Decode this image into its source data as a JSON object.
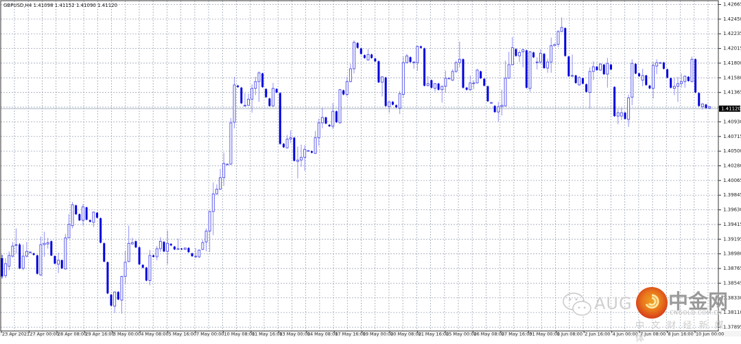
{
  "header": {
    "symbol": "GBPUSD,H4",
    "ohlc": "1.41098 1.41152 1.41090 1.41120"
  },
  "watermark": {
    "prefix": "AUG",
    "brand": "中金网",
    "domain": "CNGOLD.COM.CN",
    "slogan": "中 文 财 经 新 媒 体"
  },
  "colors": {
    "bull": "#4b4be8",
    "bear": "#0000dd",
    "wick": "#6a6af0",
    "grid": "#9aa4b4",
    "price_line": "#a8b4c4",
    "price_box": "#000000"
  },
  "chart_data": {
    "type": "candlestick",
    "title": "GBPUSD,H4",
    "ylim": [
      1.37895,
      1.42665
    ],
    "current_price": 1.4112,
    "current_price_label": "1.41120",
    "y_ticks": [
      "1.42665",
      "1.42450",
      "1.42235",
      "1.42015",
      "1.41800",
      "1.41580",
      "1.41365",
      "1.41145",
      "1.40930",
      "1.40715",
      "1.40500",
      "1.40280",
      "1.40065",
      "1.39845",
      "1.39630",
      "1.39415",
      "1.39195",
      "1.38980",
      "1.38765",
      "1.38545",
      "1.38330",
      "1.38110",
      "1.37895"
    ],
    "x_ticks": [
      "23 Apr 2021",
      "27 Apr 00:00",
      "28 Apr 08:00",
      "29 Apr 16:00",
      "3 May 00:00",
      "4 May 08:00",
      "5 May 16:00",
      "7 May 00:00",
      "10 May 08:00",
      "11 May 16:00",
      "13 May 00:00",
      "14 May 08:00",
      "17 May 16:00",
      "19 May 00:00",
      "20 May 08:00",
      "21 May 16:00",
      "25 May 00:00",
      "26 May 08:00",
      "27 May 16:00",
      "31 May 00:00",
      "1 Jun 08:00",
      "2 Jun 16:00",
      "4 Jun 00:00",
      "7 Jun 08:00",
      "8 Jun 16:00",
      "10 Jun 00:00"
    ],
    "candles_ohlc": [
      [
        1.3891,
        1.3896,
        1.3861,
        1.3864
      ],
      [
        1.3865,
        1.3891,
        1.3862,
        1.3883
      ],
      [
        1.3879,
        1.3901,
        1.3873,
        1.3895
      ],
      [
        1.3894,
        1.3915,
        1.3892,
        1.3909
      ],
      [
        1.391,
        1.3935,
        1.3898,
        1.3911
      ],
      [
        1.3911,
        1.3913,
        1.3875,
        1.3876
      ],
      [
        1.3876,
        1.3911,
        1.3873,
        1.3894
      ],
      [
        1.3894,
        1.3915,
        1.3892,
        1.3901
      ],
      [
        1.39,
        1.3901,
        1.3899,
        1.39
      ],
      [
        1.3898,
        1.3899,
        1.3895,
        1.3896
      ],
      [
        1.3895,
        1.3896,
        1.3867,
        1.3868
      ],
      [
        1.3866,
        1.3923,
        1.3865,
        1.3911
      ],
      [
        1.3911,
        1.393,
        1.3893,
        1.3913
      ],
      [
        1.3912,
        1.3921,
        1.3905,
        1.3914
      ],
      [
        1.3916,
        1.3917,
        1.3894,
        1.3895
      ],
      [
        1.3894,
        1.3895,
        1.3882,
        1.3883
      ],
      [
        1.3882,
        1.3899,
        1.3869,
        1.3888
      ],
      [
        1.3888,
        1.3889,
        1.3875,
        1.3876
      ],
      [
        1.3875,
        1.3927,
        1.3874,
        1.3921
      ],
      [
        1.3921,
        1.3956,
        1.3921,
        1.3941
      ],
      [
        1.3939,
        1.3974,
        1.3935,
        1.397
      ],
      [
        1.3969,
        1.397,
        1.3955,
        1.3956
      ],
      [
        1.3956,
        1.3957,
        1.3946,
        1.3947
      ],
      [
        1.3947,
        1.3971,
        1.3939,
        1.3967
      ],
      [
        1.3966,
        1.3967,
        1.3947,
        1.3948
      ],
      [
        1.3947,
        1.3948,
        1.3944,
        1.3945
      ],
      [
        1.3944,
        1.396,
        1.3937,
        1.3959
      ],
      [
        1.3958,
        1.3959,
        1.395,
        1.3951
      ],
      [
        1.395,
        1.3951,
        1.3913,
        1.3914
      ],
      [
        1.3913,
        1.3914,
        1.3885,
        1.3886
      ],
      [
        1.3885,
        1.3886,
        1.3838,
        1.3839
      ],
      [
        1.3837,
        1.3838,
        1.382,
        1.3821
      ],
      [
        1.382,
        1.3842,
        1.381,
        1.3841
      ],
      [
        1.3841,
        1.3842,
        1.3829,
        1.383
      ],
      [
        1.3829,
        1.3865,
        1.3809,
        1.3864
      ],
      [
        1.3864,
        1.3902,
        1.3853,
        1.3885
      ],
      [
        1.3886,
        1.3939,
        1.3885,
        1.3913
      ],
      [
        1.3912,
        1.3921,
        1.3911,
        1.3914
      ],
      [
        1.3916,
        1.3917,
        1.3906,
        1.3907
      ],
      [
        1.3907,
        1.3908,
        1.3881,
        1.3882
      ],
      [
        1.3881,
        1.3882,
        1.3876,
        1.3877
      ],
      [
        1.3877,
        1.3878,
        1.3857,
        1.3858
      ],
      [
        1.3858,
        1.3903,
        1.3851,
        1.3895
      ],
      [
        1.3895,
        1.3896,
        1.3892,
        1.3893
      ],
      [
        1.3893,
        1.3909,
        1.3888,
        1.3905
      ],
      [
        1.3905,
        1.3922,
        1.39,
        1.3916
      ],
      [
        1.3915,
        1.3916,
        1.39,
        1.3901
      ],
      [
        1.3901,
        1.3932,
        1.3882,
        1.3913
      ],
      [
        1.3912,
        1.3913,
        1.3909,
        1.391
      ],
      [
        1.3908,
        1.3909,
        1.3903,
        1.3904
      ],
      [
        1.3905,
        1.392,
        1.3904,
        1.3905
      ],
      [
        1.3905,
        1.3906,
        1.3903,
        1.3904
      ],
      [
        1.3904,
        1.3907,
        1.3903,
        1.3906
      ],
      [
        1.3906,
        1.3907,
        1.3899,
        1.39
      ],
      [
        1.3898,
        1.3899,
        1.3893,
        1.3894
      ],
      [
        1.3894,
        1.3906,
        1.3891,
        1.3894
      ],
      [
        1.3893,
        1.3904,
        1.3891,
        1.3903
      ],
      [
        1.3904,
        1.3918,
        1.3903,
        1.3914
      ],
      [
        1.3915,
        1.3935,
        1.3901,
        1.3931
      ],
      [
        1.3931,
        1.3961,
        1.39,
        1.396
      ],
      [
        1.396,
        1.4003,
        1.3925,
        1.3986
      ],
      [
        1.3986,
        1.4,
        1.3985,
        1.3993
      ],
      [
        1.3993,
        1.4023,
        1.3992,
        1.401
      ],
      [
        1.401,
        1.4047,
        1.3998,
        1.4031
      ],
      [
        1.403,
        1.4031,
        1.4029,
        1.403
      ],
      [
        1.403,
        1.4098,
        1.4029,
        1.4091
      ],
      [
        1.4092,
        1.4159,
        1.4083,
        1.4147
      ],
      [
        1.4146,
        1.4147,
        1.4143,
        1.4144
      ],
      [
        1.4143,
        1.4144,
        1.4119,
        1.412
      ],
      [
        1.4117,
        1.4135,
        1.4115,
        1.4117
      ],
      [
        1.4117,
        1.4134,
        1.4117,
        1.4126
      ],
      [
        1.4126,
        1.4148,
        1.4106,
        1.4142
      ],
      [
        1.4142,
        1.4159,
        1.4132,
        1.4152
      ],
      [
        1.4152,
        1.4167,
        1.4122,
        1.4165
      ],
      [
        1.4164,
        1.4165,
        1.4143,
        1.4144
      ],
      [
        1.4141,
        1.4142,
        1.4128,
        1.4129
      ],
      [
        1.4127,
        1.4128,
        1.4115,
        1.4116
      ],
      [
        1.4116,
        1.415,
        1.4115,
        1.4142
      ],
      [
        1.4141,
        1.4142,
        1.4135,
        1.4136
      ],
      [
        1.4135,
        1.4136,
        1.4059,
        1.406
      ],
      [
        1.406,
        1.4061,
        1.4054,
        1.4055
      ],
      [
        1.4054,
        1.4073,
        1.4053,
        1.4067
      ],
      [
        1.4067,
        1.408,
        1.4061,
        1.4069
      ],
      [
        1.4069,
        1.407,
        1.4034,
        1.4035
      ],
      [
        1.4034,
        1.4056,
        1.4009,
        1.4036
      ],
      [
        1.4036,
        1.4059,
        1.4026,
        1.404
      ],
      [
        1.404,
        1.4058,
        1.402,
        1.4052
      ],
      [
        1.405,
        1.4051,
        1.4049,
        1.405
      ],
      [
        1.4049,
        1.405,
        1.4046,
        1.4047
      ],
      [
        1.4046,
        1.4079,
        1.4045,
        1.4069
      ],
      [
        1.4069,
        1.4097,
        1.4057,
        1.4091
      ],
      [
        1.4091,
        1.4113,
        1.4083,
        1.4099
      ],
      [
        1.4099,
        1.41,
        1.4089,
        1.409
      ],
      [
        1.4088,
        1.4089,
        1.4085,
        1.4086
      ],
      [
        1.4086,
        1.412,
        1.4082,
        1.4108
      ],
      [
        1.4108,
        1.4109,
        1.4091,
        1.4092
      ],
      [
        1.4091,
        1.4141,
        1.409,
        1.414
      ],
      [
        1.4139,
        1.414,
        1.4132,
        1.4133
      ],
      [
        1.4133,
        1.4159,
        1.413,
        1.4152
      ],
      [
        1.4152,
        1.4178,
        1.4151,
        1.4171
      ],
      [
        1.4171,
        1.4213,
        1.4164,
        1.421
      ],
      [
        1.4209,
        1.421,
        1.4201,
        1.4202
      ],
      [
        1.4201,
        1.4202,
        1.4192,
        1.4193
      ],
      [
        1.4191,
        1.4192,
        1.4186,
        1.4187
      ],
      [
        1.4184,
        1.42,
        1.4183,
        1.4192
      ],
      [
        1.4192,
        1.4193,
        1.4186,
        1.4187
      ],
      [
        1.4186,
        1.4187,
        1.4181,
        1.4182
      ],
      [
        1.4182,
        1.4183,
        1.415,
        1.4151
      ],
      [
        1.4151,
        1.416,
        1.413,
        1.4159
      ],
      [
        1.4158,
        1.4159,
        1.4115,
        1.4116
      ],
      [
        1.4115,
        1.4123,
        1.4106,
        1.4122
      ],
      [
        1.4122,
        1.4123,
        1.4117,
        1.4118
      ],
      [
        1.4117,
        1.4118,
        1.4113,
        1.4114
      ],
      [
        1.4113,
        1.4138,
        1.4104,
        1.4134
      ],
      [
        1.4133,
        1.4189,
        1.4128,
        1.418
      ],
      [
        1.418,
        1.4193,
        1.4179,
        1.419
      ],
      [
        1.4188,
        1.4189,
        1.418,
        1.4181
      ],
      [
        1.4181,
        1.4182,
        1.4171,
        1.4181
      ],
      [
        1.418,
        1.4205,
        1.4168,
        1.4204
      ],
      [
        1.4204,
        1.4205,
        1.4201,
        1.4202
      ],
      [
        1.4201,
        1.4202,
        1.4145,
        1.4146
      ],
      [
        1.4146,
        1.416,
        1.4145,
        1.4149
      ],
      [
        1.4154,
        1.4155,
        1.4142,
        1.4143
      ],
      [
        1.4142,
        1.415,
        1.4137,
        1.4149
      ],
      [
        1.4149,
        1.415,
        1.4139,
        1.414
      ],
      [
        1.414,
        1.4146,
        1.4121,
        1.4145
      ],
      [
        1.4145,
        1.4168,
        1.4136,
        1.4157
      ],
      [
        1.4157,
        1.4158,
        1.4156,
        1.4157
      ],
      [
        1.4154,
        1.417,
        1.4153,
        1.4167
      ],
      [
        1.4167,
        1.4183,
        1.4165,
        1.418
      ],
      [
        1.418,
        1.4211,
        1.4173,
        1.4185
      ],
      [
        1.4185,
        1.4186,
        1.4142,
        1.4143
      ],
      [
        1.4143,
        1.4144,
        1.4139,
        1.414
      ],
      [
        1.414,
        1.4161,
        1.4138,
        1.415
      ],
      [
        1.415,
        1.4154,
        1.4141,
        1.415
      ],
      [
        1.415,
        1.4171,
        1.4149,
        1.4169
      ],
      [
        1.4167,
        1.4168,
        1.4156,
        1.4157
      ],
      [
        1.4156,
        1.4157,
        1.4145,
        1.4146
      ],
      [
        1.4145,
        1.4146,
        1.4122,
        1.4123
      ],
      [
        1.4121,
        1.4122,
        1.412,
        1.4121
      ],
      [
        1.4116,
        1.4117,
        1.4106,
        1.4107
      ],
      [
        1.4107,
        1.4122,
        1.4093,
        1.4115
      ],
      [
        1.4115,
        1.414,
        1.4102,
        1.4117
      ],
      [
        1.4116,
        1.4183,
        1.4115,
        1.4157
      ],
      [
        1.4157,
        1.4196,
        1.4156,
        1.4177
      ],
      [
        1.4177,
        1.4218,
        1.4176,
        1.4202
      ],
      [
        1.42,
        1.4201,
        1.4189,
        1.419
      ],
      [
        1.419,
        1.4198,
        1.4181,
        1.4195
      ],
      [
        1.4196,
        1.4201,
        1.4173,
        1.4199
      ],
      [
        1.4198,
        1.4199,
        1.4142,
        1.4143
      ],
      [
        1.4142,
        1.4197,
        1.4137,
        1.4196
      ],
      [
        1.4195,
        1.4196,
        1.4187,
        1.4188
      ],
      [
        1.4181,
        1.4188,
        1.417,
        1.4181
      ],
      [
        1.4181,
        1.42,
        1.4178,
        1.4194
      ],
      [
        1.4193,
        1.4194,
        1.4171,
        1.4172
      ],
      [
        1.4172,
        1.4186,
        1.4165,
        1.4181
      ],
      [
        1.4181,
        1.4217,
        1.4165,
        1.4205
      ],
      [
        1.4205,
        1.4208,
        1.4204,
        1.4207
      ],
      [
        1.4207,
        1.4228,
        1.4203,
        1.4226
      ],
      [
        1.4226,
        1.4247,
        1.4225,
        1.4232
      ],
      [
        1.4231,
        1.4232,
        1.4189,
        1.419
      ],
      [
        1.4189,
        1.419,
        1.4159,
        1.416
      ],
      [
        1.416,
        1.4192,
        1.4159,
        1.4161
      ],
      [
        1.4161,
        1.4162,
        1.4149,
        1.415
      ],
      [
        1.4147,
        1.416,
        1.4146,
        1.4158
      ],
      [
        1.4157,
        1.4158,
        1.4148,
        1.4149
      ],
      [
        1.4148,
        1.4149,
        1.4136,
        1.4137
      ],
      [
        1.4136,
        1.4173,
        1.4112,
        1.4167
      ],
      [
        1.4167,
        1.4182,
        1.4154,
        1.4174
      ],
      [
        1.4174,
        1.4175,
        1.4168,
        1.4169
      ],
      [
        1.4169,
        1.4179,
        1.4168,
        1.4178
      ],
      [
        1.4177,
        1.4178,
        1.4162,
        1.4163
      ],
      [
        1.4163,
        1.4187,
        1.4143,
        1.4179
      ],
      [
        1.4177,
        1.4178,
        1.4169,
        1.417
      ],
      [
        1.4144,
        1.4145,
        1.41,
        1.4101
      ],
      [
        1.4101,
        1.4111,
        1.4089,
        1.4106
      ],
      [
        1.4101,
        1.4113,
        1.4095,
        1.4106
      ],
      [
        1.4106,
        1.4107,
        1.4096,
        1.4097
      ],
      [
        1.4096,
        1.4133,
        1.4085,
        1.4128
      ],
      [
        1.4129,
        1.4185,
        1.4117,
        1.4179
      ],
      [
        1.4178,
        1.4179,
        1.4163,
        1.4164
      ],
      [
        1.4164,
        1.4165,
        1.4159,
        1.416
      ],
      [
        1.4154,
        1.4171,
        1.4145,
        1.4161
      ],
      [
        1.4161,
        1.4162,
        1.4146,
        1.4147
      ],
      [
        1.4146,
        1.4147,
        1.4141,
        1.4142
      ],
      [
        1.4142,
        1.4181,
        1.4127,
        1.4176
      ],
      [
        1.4175,
        1.4185,
        1.4163,
        1.418
      ],
      [
        1.418,
        1.4181,
        1.4179,
        1.418
      ],
      [
        1.418,
        1.4181,
        1.417,
        1.4171
      ],
      [
        1.417,
        1.4171,
        1.4157,
        1.4158
      ],
      [
        1.4157,
        1.4158,
        1.4142,
        1.4143
      ],
      [
        1.4142,
        1.4158,
        1.4132,
        1.4145
      ],
      [
        1.4145,
        1.4159,
        1.4122,
        1.4149
      ],
      [
        1.4149,
        1.4164,
        1.4143,
        1.4152
      ],
      [
        1.4152,
        1.4161,
        1.4143,
        1.416
      ],
      [
        1.4159,
        1.416,
        1.4152,
        1.4153
      ],
      [
        1.4152,
        1.4189,
        1.4151,
        1.4185
      ],
      [
        1.4185,
        1.4186,
        1.4135,
        1.4136
      ],
      [
        1.4135,
        1.4136,
        1.4115,
        1.4116
      ],
      [
        1.4115,
        1.412,
        1.4111,
        1.4119
      ],
      [
        1.4118,
        1.4119,
        1.4112,
        1.4113
      ],
      [
        1.4113,
        1.4116,
        1.4111,
        1.4115
      ]
    ]
  }
}
